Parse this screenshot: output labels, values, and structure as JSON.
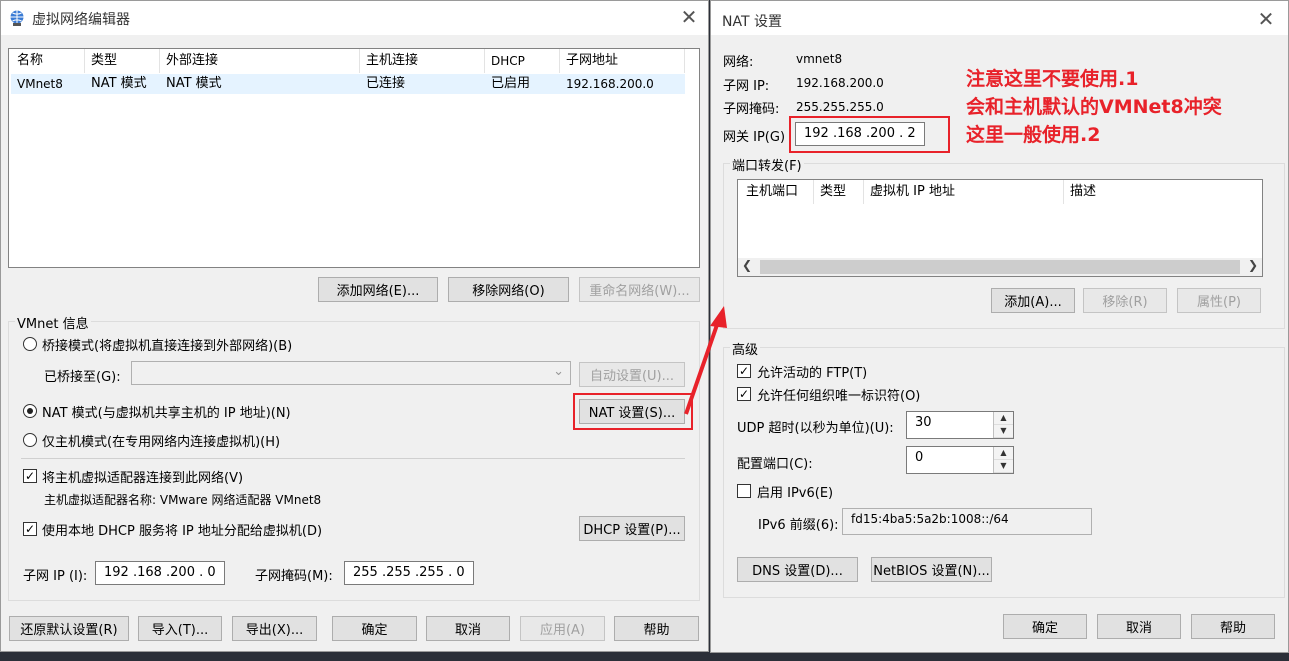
{
  "colors": {
    "accent_red": "#e8222a",
    "selection": "#e5f3ff"
  },
  "left_window": {
    "title": "虚拟网络编辑器",
    "table": {
      "headers": [
        "名称",
        "类型",
        "外部连接",
        "主机连接",
        "DHCP",
        "子网地址"
      ],
      "rows": [
        [
          "VMnet8",
          "NAT 模式",
          "NAT 模式",
          "已连接",
          "已启用",
          "192.168.200.0"
        ]
      ]
    },
    "add_network": "添加网络(E)...",
    "remove_network": "移除网络(O)",
    "rename_network": "重命名网络(W)...",
    "vmnet_info": "VMnet 信息",
    "bridged_mode": "桥接模式(将虚拟机直接连接到外部网络)(B)",
    "bridged_to": "已桥接至(G):",
    "auto_settings": "自动设置(U)...",
    "nat_mode": "NAT 模式(与虚拟机共享主机的 IP 地址)(N)",
    "nat_settings": "NAT 设置(S)...",
    "host_only": "仅主机模式(在专用网络内连接虚拟机)(H)",
    "connect_adapter": "将主机虚拟适配器连接到此网络(V)",
    "adapter_name": "主机虚拟适配器名称: VMware 网络适配器 VMnet8",
    "use_dhcp": "使用本地 DHCP 服务将 IP 地址分配给虚拟机(D)",
    "dhcp_settings": "DHCP 设置(P)...",
    "subnet_ip_label": "子网 IP (I):",
    "subnet_ip": "192 .168 .200 .  0",
    "subnet_mask_label": "子网掩码(M):",
    "subnet_mask": "255 .255 .255 .  0",
    "restore_defaults": "还原默认设置(R)",
    "import": "导入(T)...",
    "export": "导出(X)...",
    "ok": "确定",
    "cancel": "取消",
    "apply": "应用(A)",
    "help": "帮助"
  },
  "right_window": {
    "title": "NAT 设置",
    "network_label": "网络:",
    "network_value": "vmnet8",
    "subnet_ip_label": "子网 IP:",
    "subnet_ip_value": "192.168.200.0",
    "subnet_mask_label": "子网掩码:",
    "subnet_mask_value": "255.255.255.0",
    "gateway_label": "网关 IP(G)",
    "gateway_value": "192 .168 .200 .  2",
    "port_forwarding": "端口转发(F)",
    "pf_headers": [
      "主机端口",
      "类型",
      "虚拟机 IP 地址",
      "描述"
    ],
    "add": "添加(A)...",
    "remove": "移除(R)",
    "properties": "属性(P)",
    "advanced": "高级",
    "allow_ftp": "允许活动的 FTP(T)",
    "allow_oui": "允许任何组织唯一标识符(O)",
    "udp_timeout_label": "UDP 超时(以秒为单位)(U):",
    "udp_timeout": "30",
    "config_port_label": "配置端口(C):",
    "config_port": "0",
    "enable_ipv6": "启用 IPv6(E)",
    "ipv6_prefix_label": "IPv6 前缀(6):",
    "ipv6_prefix": "fd15:4ba5:5a2b:1008::/64",
    "dns_settings": "DNS 设置(D)...",
    "netbios_settings": "NetBIOS 设置(N)...",
    "ok": "确定",
    "cancel": "取消",
    "help": "帮助"
  },
  "annotation": {
    "line1": "注意这里不要使用.1",
    "line2": "会和主机默认的VMNet8冲突",
    "line3": "这里一般使用.2"
  }
}
